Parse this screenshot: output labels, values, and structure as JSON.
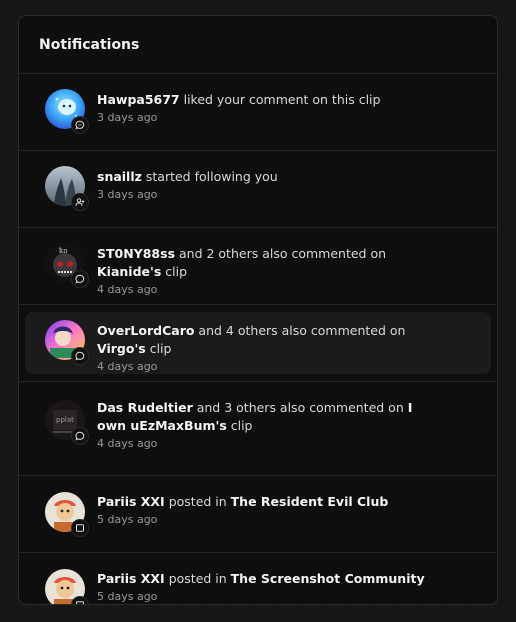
{
  "header": {
    "title": "Notifications"
  },
  "notifications": [
    {
      "user": "Hawpa5677",
      "text1": " liked your comment on this clip",
      "target": "",
      "text2": "",
      "time": "3 days ago",
      "badge_icon": "comment-icon"
    },
    {
      "user": "snaillz",
      "text1": " started following you",
      "target": "",
      "text2": "",
      "time": "3 days ago",
      "badge_icon": "user-plus-icon"
    },
    {
      "user": "ST0NY88ss",
      "text1": " and 2 others also commented on ",
      "target": "Kianide's",
      "text2": " clip",
      "time": "4 days ago",
      "badge_icon": "comment-icon"
    },
    {
      "user": "OverLordCaro",
      "text1": " and 4 others also commented on ",
      "target": "Virgo's",
      "text2": " clip",
      "time": "4 days ago",
      "badge_icon": "comment-icon"
    },
    {
      "user": "Das Rudeltier",
      "text1": " and 3 others also commented on ",
      "target": "I own uEzMaxBum's",
      "text2": " clip",
      "time": "4 days ago",
      "badge_icon": "comment-icon"
    },
    {
      "user": "Pariis XXI",
      "text1": " posted in ",
      "target": "The Resident Evil Club",
      "text2": "",
      "time": "5 days ago",
      "badge_icon": "post-icon"
    },
    {
      "user": "Pariis XXI",
      "text1": " posted in ",
      "target": "The Screenshot Community",
      "text2": "",
      "time": "5 days ago",
      "badge_icon": "post-icon"
    }
  ]
}
